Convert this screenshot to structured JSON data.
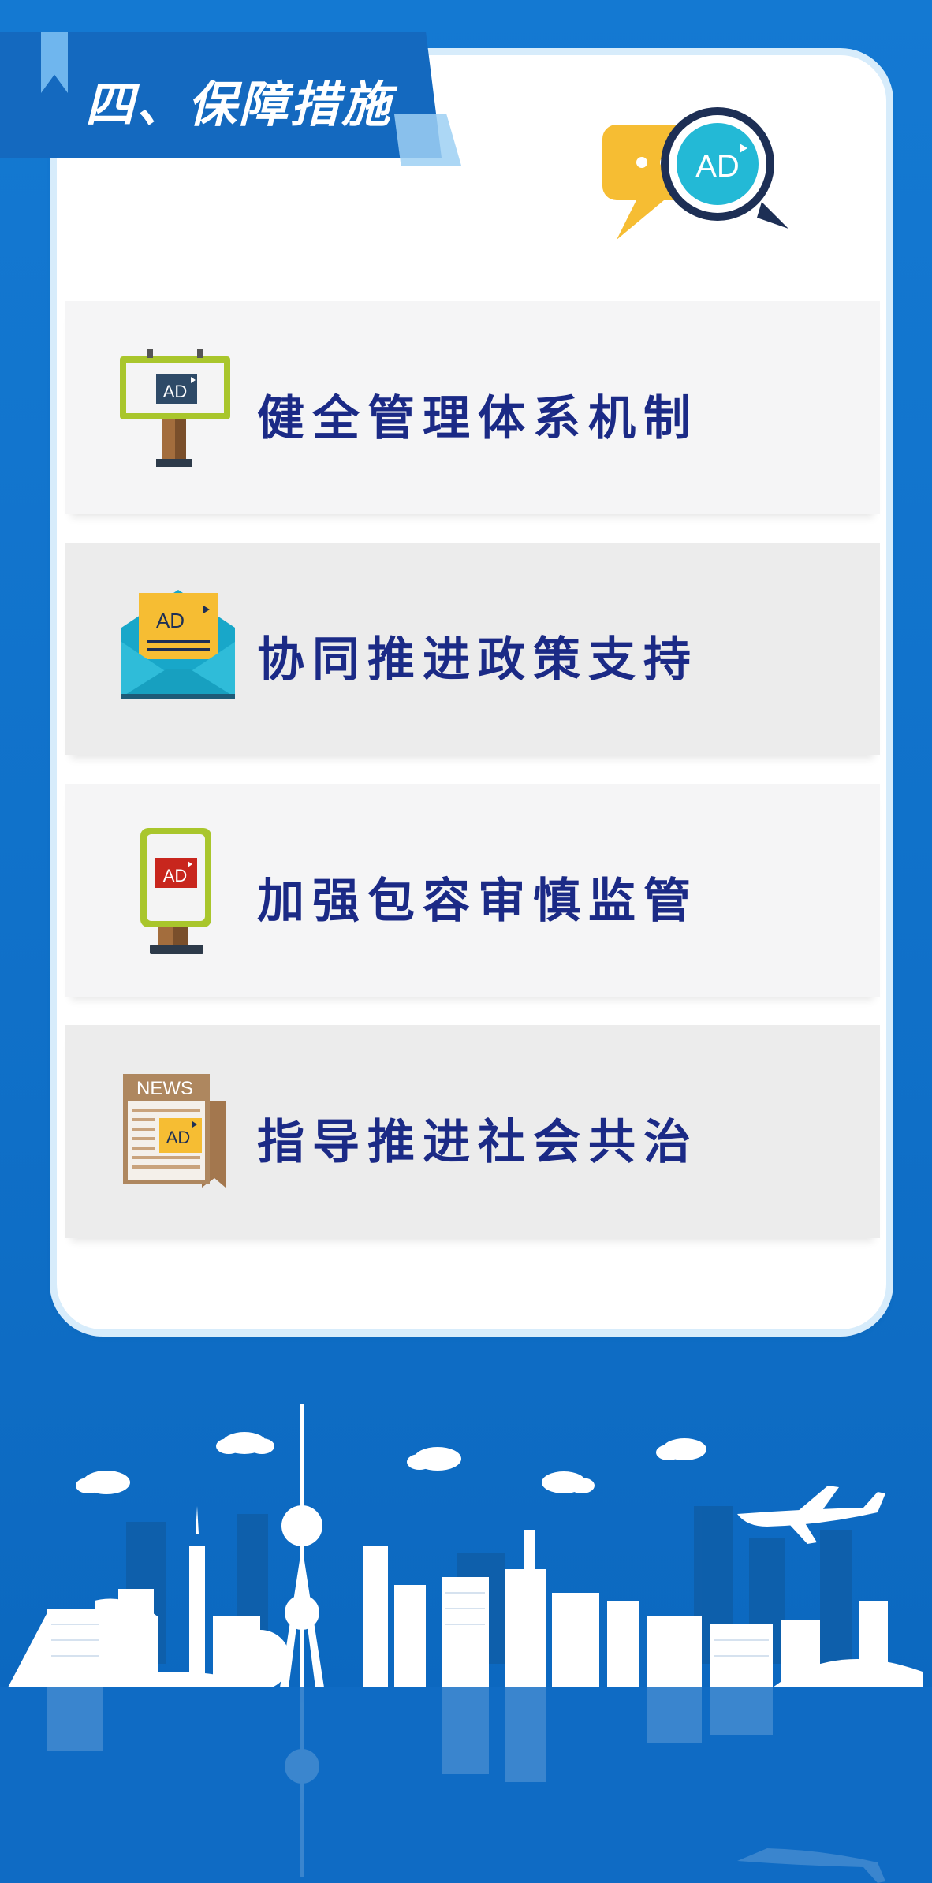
{
  "heading": {
    "title": "四、保障措施"
  },
  "header_icon": {
    "text": "AD",
    "name": "ad-chat-bubble-icon"
  },
  "sections": [
    {
      "label": "健全管理体系机制",
      "icon": "ad-billboard-icon",
      "icon_text": "AD"
    },
    {
      "label": "协同推进政策支持",
      "icon": "ad-envelope-icon",
      "icon_text": "AD"
    },
    {
      "label": "加强包容审慎监管",
      "icon": "ad-lightbox-icon",
      "icon_text": "AD"
    },
    {
      "label": "指导推进社会共治",
      "icon": "ad-newspaper-icon",
      "icon_text": "AD",
      "icon_title": "NEWS"
    }
  ],
  "colors": {
    "background": "#1277cf",
    "heading_ribbon": "#1469bf",
    "label_text": "#1b2a86",
    "card": "#ffffff"
  }
}
